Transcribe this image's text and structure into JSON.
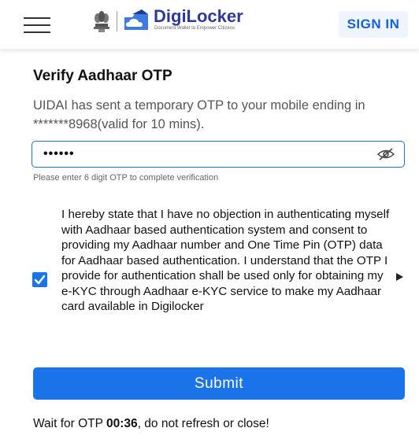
{
  "header": {
    "logo_name": "DigiLocker",
    "logo_tagline": "Document Wallet to Empower Citizens",
    "signin_label": "SIGN IN",
    "brand_color": "#2d3a9a",
    "icons": [
      "hamburger-menu-icon",
      "national-emblem-icon",
      "cloud-folder-icon"
    ]
  },
  "verify": {
    "title": "Verify Aadhaar OTP",
    "description": "UIDAI has sent a temporary OTP to your mobile ending in *******8968(valid for 10 mins).",
    "otp_value": "••••••",
    "otp_hint": "Please enter 6 digit OTP to complete verification",
    "eye_icon": "eye-slash-icon"
  },
  "consent": {
    "checked": true,
    "text": "I hereby state that I have no objection in authenticating myself with Aadhaar based authentication system and consent to providing my Aadhaar number and One Time Pin (OTP) data for Aadhaar based authentication. I understand that the OTP I provide for authentication shall be used only for obtaining my e-KYC through Aadhaar e-KYC service to make my Aadhaar card available in Digilocker"
  },
  "submit_label": "Submit",
  "accent_color": "#1a73e8",
  "wait": {
    "prefix": "Wait for OTP ",
    "timer": "00:36",
    "suffix": ", do not refresh or close!"
  }
}
